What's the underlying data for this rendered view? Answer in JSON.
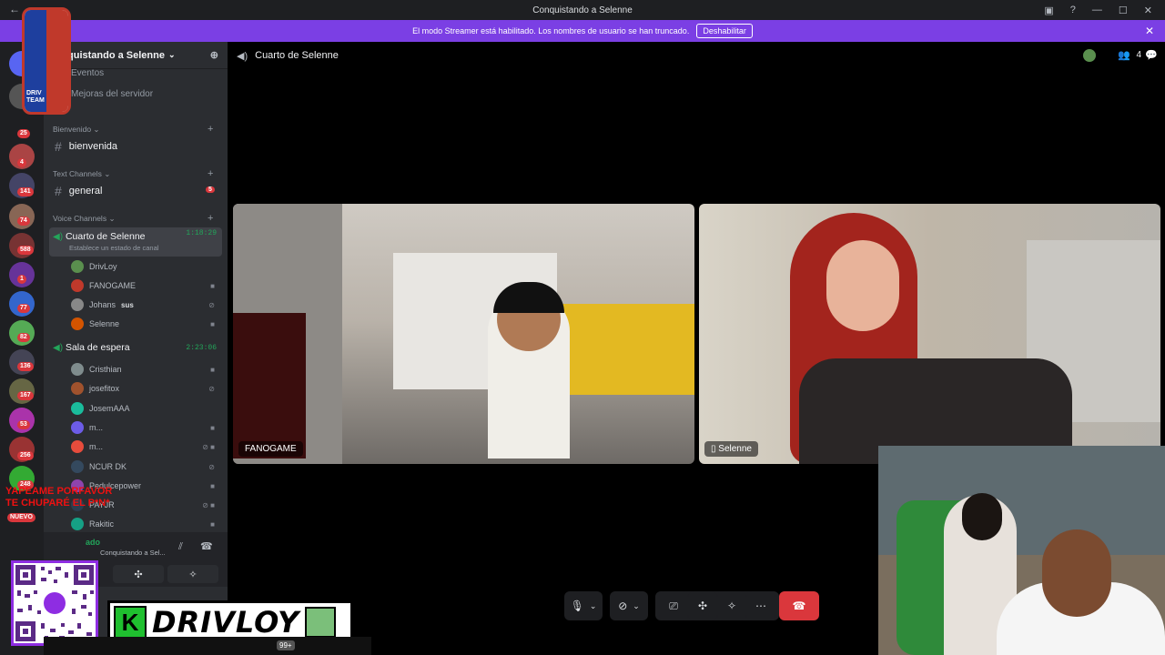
{
  "window": {
    "title": "Conquistando a Selenne"
  },
  "banner": {
    "text": "El modo Streamer está habilitado. Los nombres de usuario se han truncado.",
    "button": "Deshabilitar"
  },
  "server_badges": [
    "25",
    "4",
    "141",
    "74",
    "588",
    "1",
    "77",
    "82",
    "136",
    "167",
    "53",
    "256",
    "248",
    "NUEVO"
  ],
  "guild": {
    "name": "quistando a Selenne"
  },
  "menu": {
    "events": "Eventos",
    "boosts": "Mejoras del servidor"
  },
  "categories": {
    "welcome": "Bienvenido",
    "text": "Text Channels",
    "voice": "Voice Channels"
  },
  "text_channels": [
    {
      "name": "bienvenida",
      "badge": ""
    },
    {
      "name": "general",
      "badge": "5"
    }
  ],
  "voice_channels": [
    {
      "name": "Cuarto de Selenne",
      "time": "1:18:29",
      "status": "Establece un estado de canal",
      "members": [
        {
          "name": "DrivLoy",
          "tag": "",
          "color": "#5a8f4e"
        },
        {
          "name": "FANOGAME",
          "tag": "",
          "color": "#c0392b"
        },
        {
          "name": "Johans",
          "tag": "sus",
          "color": "#888888"
        },
        {
          "name": "Selenne",
          "tag": "",
          "color": "#d35400"
        }
      ]
    },
    {
      "name": "Sala de espera",
      "time": "2:23:06",
      "status": "",
      "members": [
        {
          "name": "Cristhian",
          "tag": "",
          "color": "#7f8c8d"
        },
        {
          "name": "josefitox",
          "tag": "",
          "color": "#a0522d"
        },
        {
          "name": "JosemAAA",
          "tag": "",
          "color": "#1abc9c"
        },
        {
          "name": "m...",
          "tag": "",
          "color": "#6c5ce7"
        },
        {
          "name": "m...",
          "tag": "",
          "color": "#e74c3c"
        },
        {
          "name": "NCUR DK",
          "tag": "",
          "color": "#34495e"
        },
        {
          "name": "Pedulcepower",
          "tag": "",
          "color": "#8e44ad"
        },
        {
          "name": "PAYJR",
          "tag": "",
          "color": "#2c3e50"
        },
        {
          "name": "Rakitic",
          "tag": "",
          "color": "#16a085"
        }
      ]
    }
  ],
  "userpanel": {
    "status": "ado",
    "channel": "Conquistando a Sel..."
  },
  "stage": {
    "title": "Cuarto de Selenne",
    "member_count": "4"
  },
  "tiles": [
    {
      "name": "FANOGAME"
    },
    {
      "name": "Selenne"
    }
  ],
  "overlay": {
    "line1": "YAPEAME PORFAVOR",
    "line2": "TE CHUPARÉ EL P*N*",
    "brand": "DRIVLOY",
    "k": "K",
    "logo_text": "DRIV TEAM"
  },
  "taskbar": {
    "count": "99+"
  }
}
